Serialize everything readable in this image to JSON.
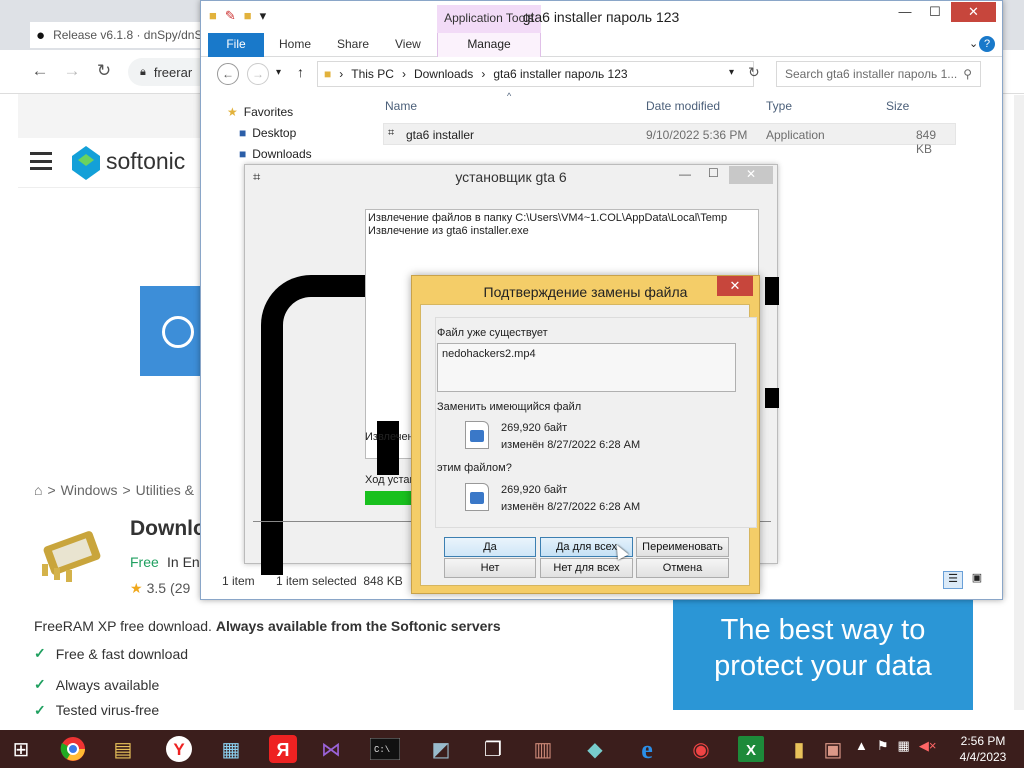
{
  "browser": {
    "tab_title": "Release v6.1.8 · dnSpy/dnS",
    "url_fragment": "freerar",
    "softonic_logo": "softonic",
    "breadcrumb": [
      "Windows",
      "Utilities &"
    ],
    "title": "Downlo",
    "free": "Free",
    "in_en": "In En",
    "rating": "3.5",
    "rating_count": "(29",
    "description_plain": "FreeRAM XP free download.",
    "description_bold": "Always available from the Softonic servers",
    "checks": [
      "Free & fast download",
      "Always available",
      "Tested virus-free"
    ],
    "ad_text": "The best way to protect your data"
  },
  "explorer": {
    "title": "gta6 installer пароль 123",
    "app_tools": "Application Tools",
    "tabs": [
      "File",
      "Home",
      "Share",
      "View",
      "Manage"
    ],
    "breadcrumb": [
      "This PC",
      "Downloads",
      "gta6 installer пароль 123"
    ],
    "search_placeholder": "Search gta6 installer пароль 1...",
    "nav": [
      "Favorites",
      "Desktop",
      "Downloads"
    ],
    "columns": [
      "Name",
      "Date modified",
      "Type",
      "Size"
    ],
    "files": [
      {
        "name": "gta6 installer",
        "date": "9/10/2022 5:36 PM",
        "type": "Application",
        "size": "849 KB"
      }
    ],
    "status_items": "1 item",
    "status_selected": "1 item selected  848 KB"
  },
  "installer": {
    "title": "установщик gta 6",
    "log_lines": [
      "Извлечение файлов в папку C:\\Users\\VM4~1.COL\\AppData\\Local\\Temp",
      "Извлечение из gta6 installer.exe"
    ],
    "extract_label": "Извлечен",
    "progress_label": "Ход устан",
    "progress": 0.15
  },
  "confirm": {
    "title": "Подтверждение замены файла",
    "exists_label": "Файл уже существует",
    "filename": "nedohackers2.mp4",
    "replace_label": "Заменить имеющийся файл",
    "existing": {
      "size": "269,920 байт",
      "modified": "изменён 8/27/2022 6:28 AM"
    },
    "with_label": "этим файлом?",
    "new": {
      "size": "269,920 байт",
      "modified": "изменён 8/27/2022 6:28 AM"
    },
    "buttons": {
      "yes": "Да",
      "yes_all": "Да для всех",
      "rename": "Переименовать",
      "no": "Нет",
      "no_all": "Нет для всех",
      "cancel": "Отмена"
    }
  },
  "taskbar": {
    "time": "2:56 PM",
    "date": "4/4/2023"
  },
  "colors": {
    "accent": "#1979ca",
    "dialog_frame": "#f4cd68",
    "close_red": "#c7463c",
    "softonic_blue": "#2b96d6",
    "progress_green": "#19c01e"
  }
}
